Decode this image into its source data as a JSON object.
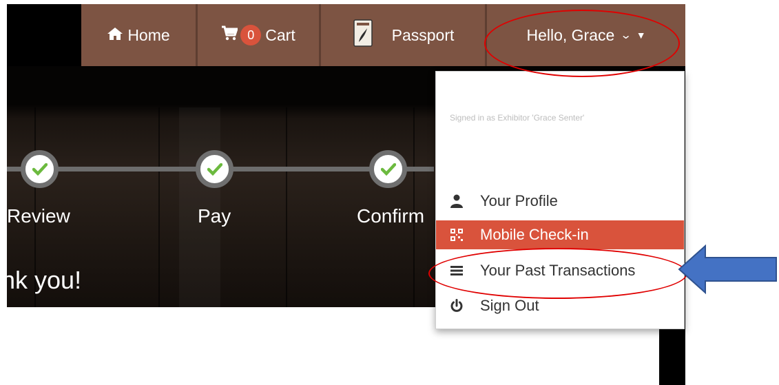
{
  "nav": {
    "home_label": "Home",
    "cart_count": "0",
    "cart_label": "Cart",
    "passport_label": "Passport",
    "greeting": "Hello, Grace"
  },
  "progress": {
    "steps": [
      {
        "label": "Review",
        "status": "complete"
      },
      {
        "label": "Pay",
        "status": "complete"
      },
      {
        "label": "Confirm",
        "status": "complete"
      }
    ]
  },
  "hero": {
    "thanks": "nk you!"
  },
  "dropdown": {
    "signed_in_text": "Signed in as Exhibitor 'Grace Senter'",
    "items": [
      {
        "label": "Your Profile",
        "icon": "user-icon"
      },
      {
        "label": "Mobile Check-in",
        "icon": "qr-code-icon",
        "active": true
      },
      {
        "label": "Your Past Transactions",
        "icon": "list-icon"
      },
      {
        "label": "Sign Out",
        "icon": "power-icon"
      }
    ]
  },
  "colors": {
    "nav_brown": "#7d5443",
    "accent_red": "#d9533c",
    "check_green": "#6cba3f",
    "annotation_red": "#e00000",
    "arrow_blue": "#4472c4"
  }
}
